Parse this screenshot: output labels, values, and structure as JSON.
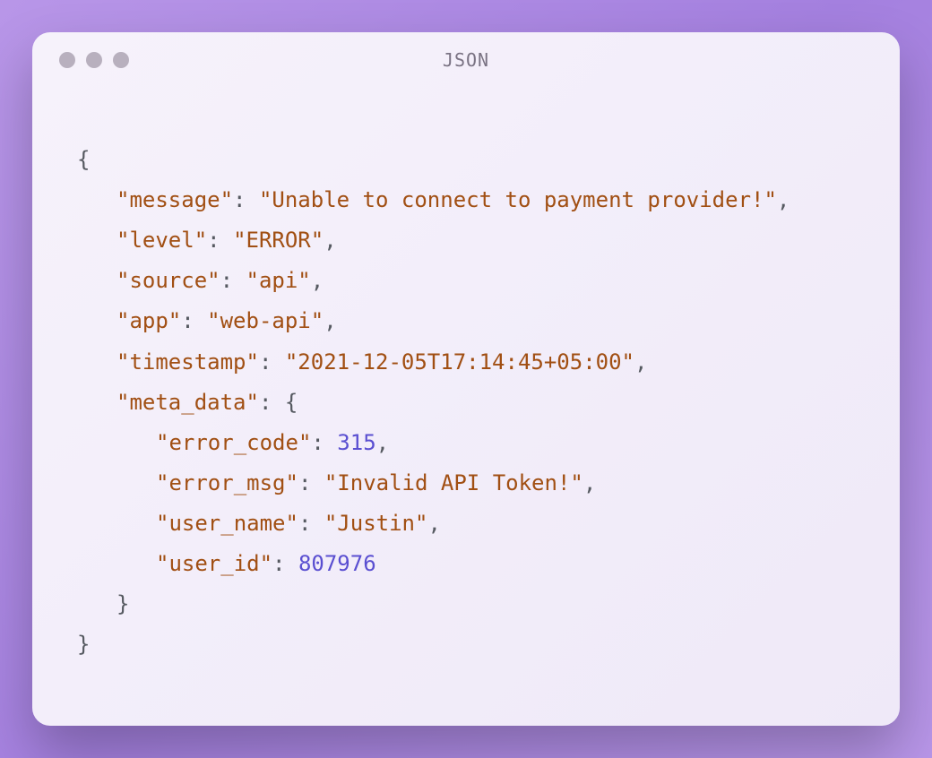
{
  "window": {
    "title": "JSON"
  },
  "code": {
    "open_brace": "{",
    "close_brace": "}",
    "inner_open_brace": "{",
    "inner_close_brace": "}",
    "lines": {
      "message_key": "\"message\"",
      "message_value": "\"Unable to connect to payment provider!\"",
      "level_key": "\"level\"",
      "level_value": "\"ERROR\"",
      "source_key": "\"source\"",
      "source_value": "\"api\"",
      "app_key": "\"app\"",
      "app_value": "\"web-api\"",
      "timestamp_key": "\"timestamp\"",
      "timestamp_value": "\"2021-12-05T17:14:45+05:00\"",
      "meta_data_key": "\"meta_data\"",
      "error_code_key": "\"error_code\"",
      "error_code_value": "315",
      "error_msg_key": "\"error_msg\"",
      "error_msg_value": "\"Invalid API Token!\"",
      "user_name_key": "\"user_name\"",
      "user_name_value": "\"Justin\"",
      "user_id_key": "\"user_id\"",
      "user_id_value": "807976"
    },
    "colon": ": ",
    "comma": ","
  }
}
